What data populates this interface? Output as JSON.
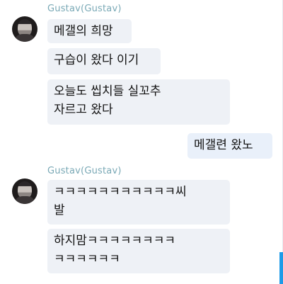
{
  "chat": {
    "groups": [
      {
        "sender": "Gustav(Gustav)",
        "messages": [
          "메갤의 희망",
          "구습이 왔다 이기",
          "오늘도 씹치들 실꼬추\n자르고 왔다"
        ]
      },
      {
        "sender": "Gustav(Gustav)",
        "messages": [
          "ㅋㅋㅋㅋㅋㅋㅋㅋㅋㅋㅋ씨\n발",
          "하지맘ㅋㅋㅋㅋㅋㅋㅋㅋ\nㅋㅋㅋㅋㅋㅋ"
        ]
      }
    ],
    "outgoing": [
      "메갤련 왔노"
    ]
  }
}
